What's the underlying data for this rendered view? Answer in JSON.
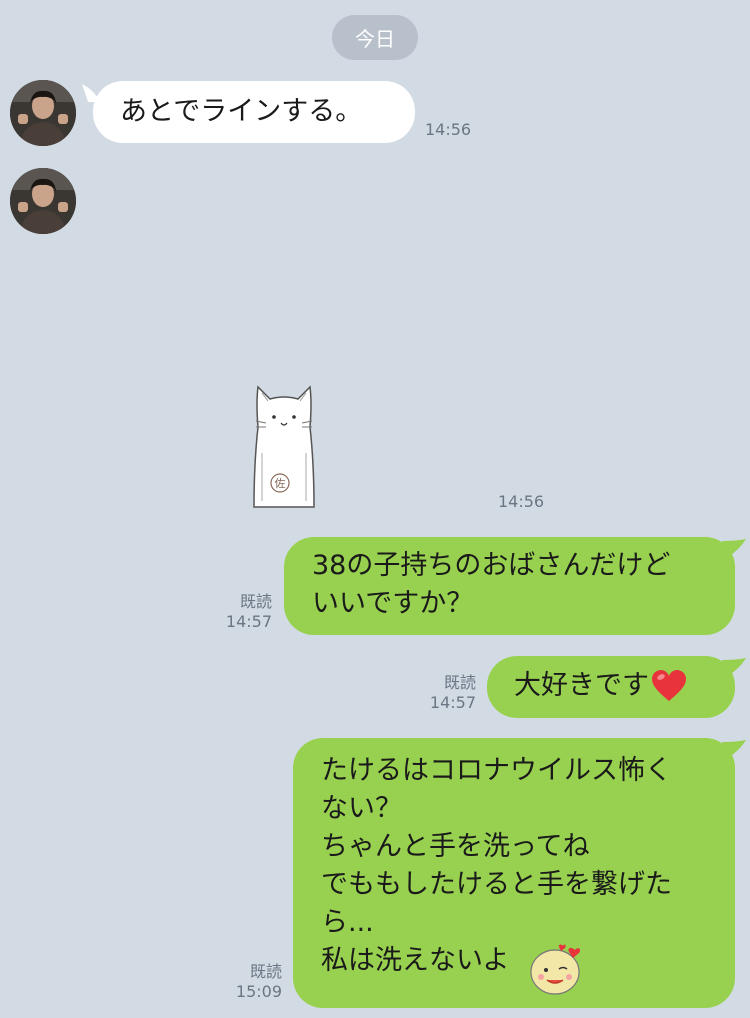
{
  "date_separator": "今日",
  "messages": [
    {
      "side": "in",
      "text": "あとでラインする。",
      "time": "14:56"
    },
    {
      "side": "in",
      "type": "sticker",
      "sticker": "cat-sticker",
      "time": "14:56"
    },
    {
      "side": "out",
      "text": "38の子持ちのおばさんだけど\nいいですか？",
      "read": "既読",
      "time": "14:57"
    },
    {
      "side": "out",
      "text": "大好きです",
      "emoji": "heart-emoji",
      "read": "既読",
      "time": "14:57"
    },
    {
      "side": "out",
      "text": "たけるはコロナウイルス怖く\nない？\nちゃんと手を洗ってね\nでももしたけると手を繋げた\nら...\n私は洗えないよ",
      "emoji": "smiling-face-emoji",
      "read": "既読",
      "time": "15:09"
    }
  ],
  "colors": {
    "background": "#d2dae4",
    "outgoing_bubble": "#98d14f",
    "incoming_bubble": "#ffffff",
    "date_pill": "#b7c0cb",
    "meta_text": "#6b7684"
  }
}
